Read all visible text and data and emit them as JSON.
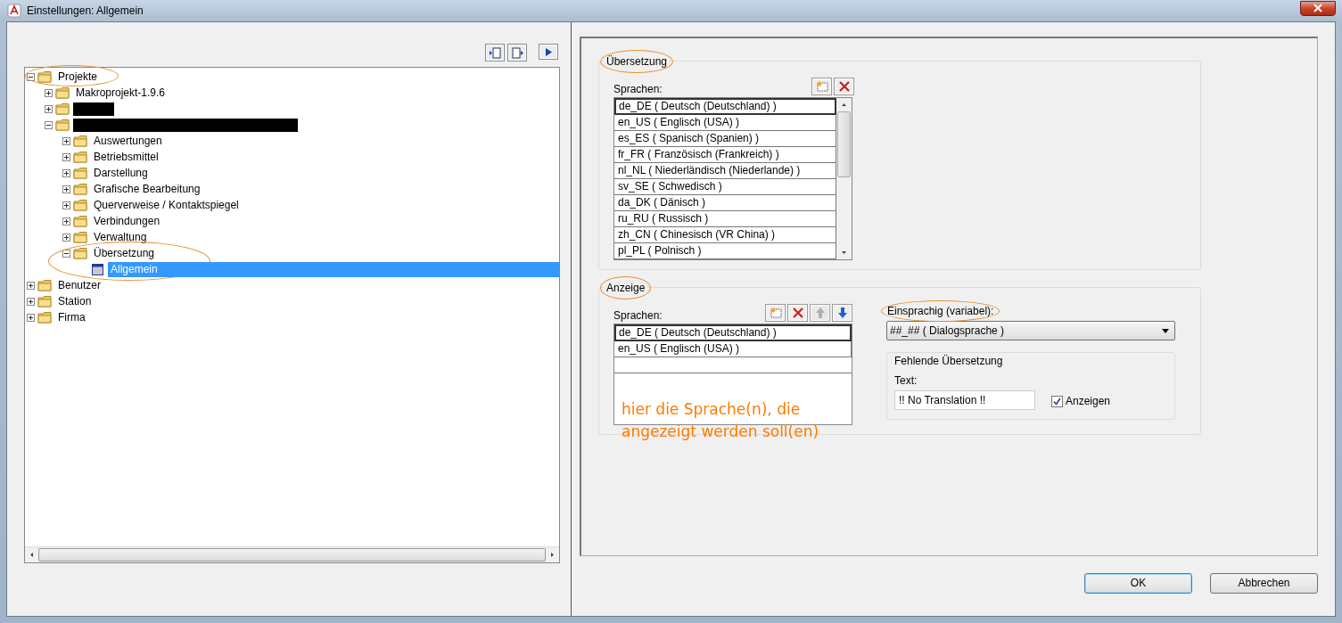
{
  "window": {
    "title": "Einstellungen: Allgemein"
  },
  "tree_toolbar": [
    {
      "kind": "expand"
    },
    {
      "kind": "collapse"
    },
    {
      "kind": "go"
    }
  ],
  "tree": [
    {
      "kind": "folder",
      "label": "Projekte",
      "expanded": true,
      "selected": false,
      "circled": true,
      "children": [
        {
          "kind": "folder",
          "label": "Makroprojekt-1.9.6",
          "expanded": false,
          "selected": false
        },
        {
          "kind": "folder",
          "redacted": true,
          "expanded": false,
          "selected": false
        },
        {
          "kind": "folder",
          "redacted": true,
          "expanded": true,
          "selected": false,
          "children": [
            {
              "kind": "folder",
              "label": "Auswertungen",
              "expanded": false,
              "selected": false
            },
            {
              "kind": "folder",
              "label": "Betriebsmittel",
              "expanded": false,
              "selected": false
            },
            {
              "kind": "folder",
              "label": "Darstellung",
              "expanded": false,
              "selected": false
            },
            {
              "kind": "folder",
              "label": "Grafische Bearbeitung",
              "expanded": false,
              "selected": false
            },
            {
              "kind": "folder",
              "label": "Querverweise / Kontaktspiegel",
              "expanded": false,
              "selected": false
            },
            {
              "kind": "folder",
              "label": "Verbindungen",
              "expanded": false,
              "selected": false
            },
            {
              "kind": "folder",
              "label": "Verwaltung",
              "expanded": false,
              "selected": false
            },
            {
              "kind": "folder",
              "label": "Übersetzung",
              "expanded": true,
              "selected": false,
              "circled": true,
              "children": [
                {
                  "kind": "page",
                  "label": "Allgemein",
                  "selected": true
                }
              ]
            }
          ]
        }
      ]
    },
    {
      "kind": "folder",
      "label": "Benutzer",
      "expanded": false,
      "selected": false
    },
    {
      "kind": "folder",
      "label": "Station",
      "expanded": false,
      "selected": false
    },
    {
      "kind": "folder",
      "label": "Firma",
      "expanded": false,
      "selected": false
    }
  ],
  "translation": {
    "legend": "Übersetzung",
    "circled": true,
    "list_label": "Sprachen:",
    "buttons": [
      {
        "kind": "new",
        "disabled": false
      },
      {
        "kind": "delete",
        "disabled": false
      }
    ],
    "languages": [
      {
        "label": "de_DE ( Deutsch (Deutschland) )",
        "selected": true
      },
      {
        "label": "en_US ( Englisch (USA) )",
        "selected": false
      },
      {
        "label": "es_ES ( Spanisch (Spanien) )",
        "selected": false
      },
      {
        "label": "fr_FR ( Französisch (Frankreich) )",
        "selected": false
      },
      {
        "label": "nl_NL ( Niederländisch (Niederlande) )",
        "selected": false
      },
      {
        "label": "sv_SE ( Schwedisch )",
        "selected": false
      },
      {
        "label": "da_DK ( Dänisch )",
        "selected": false
      },
      {
        "label": "ru_RU ( Russisch )",
        "selected": false
      },
      {
        "label": "zh_CN ( Chinesisch (VR China) )",
        "selected": false
      },
      {
        "label": "pl_PL ( Polnisch )",
        "selected": false
      }
    ]
  },
  "display": {
    "legend": "Anzeige",
    "circled": true,
    "list_label": "Sprachen:",
    "buttons": [
      {
        "kind": "new",
        "disabled": false
      },
      {
        "kind": "delete",
        "disabled": false
      },
      {
        "kind": "up",
        "disabled": true
      },
      {
        "kind": "down",
        "disabled": false
      }
    ],
    "languages": [
      {
        "label": "de_DE ( Deutsch (Deutschland) )",
        "selected": true
      },
      {
        "label": "en_US ( Englisch (USA) )",
        "selected": false
      }
    ],
    "annotation": "hier die Sprache(n), die angezeigt werden soll(en)",
    "mono_label": "Einsprachig (variabel):",
    "mono_circled": true,
    "mono_value": "##_## ( Dialogsprache )",
    "missing": {
      "legend": "Fehlende Übersetzung",
      "text_label": "Text:",
      "text_value": "!! No Translation !!",
      "show_label": "Anzeigen",
      "show_checked": true
    }
  },
  "buttons": [
    {
      "label": "OK",
      "default": true
    },
    {
      "label": "Abbrechen",
      "default": false
    }
  ]
}
